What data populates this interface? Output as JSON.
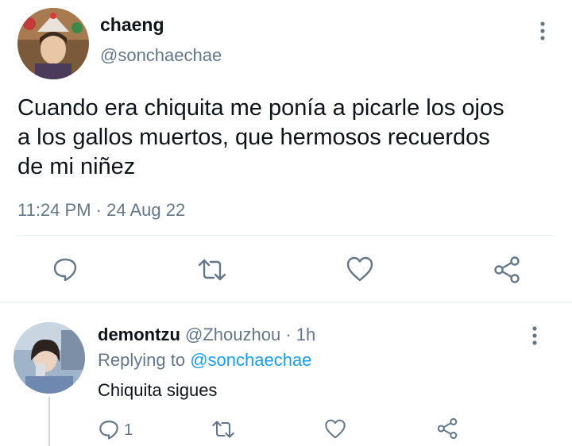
{
  "tweet": {
    "display_name": "chaeng",
    "handle": "@sonchaechae",
    "text_lines": [
      "Cuando era chiquita me ponía a picarle los ojos",
      "a los gallos muertos, que hermosos recuerdos",
      "de mi niñez"
    ],
    "time": "11:24 PM",
    "separator": "·",
    "date": "24 Aug 22",
    "more_icon": "more-vertical-icon",
    "actions": [
      "reply-icon",
      "retweet-icon",
      "like-icon",
      "share-icon"
    ]
  },
  "reply": {
    "display_name": "demontzu",
    "handle": "@Zhouzhou",
    "separator": "·",
    "age": "1h",
    "replying_prefix": "Replying to",
    "replying_to": "@sonchaechae",
    "text": "Chiquita sigues",
    "reply_count": "1",
    "more_icon": "more-vertical-icon",
    "actions": [
      "reply-icon",
      "retweet-icon",
      "like-icon",
      "share-icon"
    ]
  },
  "colors": {
    "text": "#0f1419",
    "muted": "#657786",
    "link": "#1d9bf0",
    "divider": "#e6ecf0"
  }
}
